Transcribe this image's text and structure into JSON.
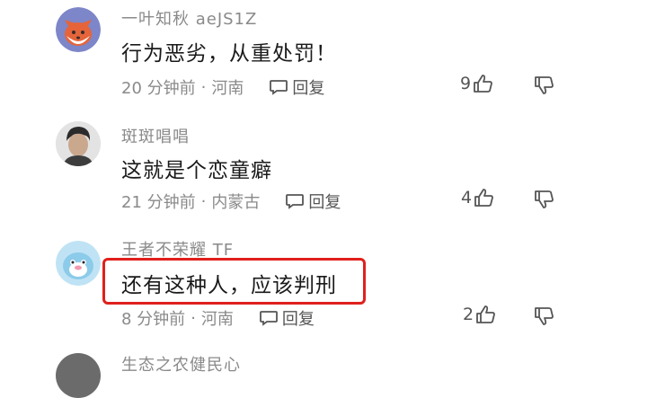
{
  "comments": [
    {
      "username": "一叶知秋 aeJS1Z",
      "content": "行为恶劣，从重处罚！",
      "time": "20 分钟前",
      "location": "河南",
      "reply_label": "回复",
      "likes": "9"
    },
    {
      "username": "斑斑唱唱",
      "content": "这就是个恋童癖",
      "time": "21 分钟前",
      "location": "内蒙古",
      "reply_label": "回复",
      "likes": "4"
    },
    {
      "username": "王者不荣耀 TF",
      "content": "还有这种人，应该判刑",
      "time": "8 分钟前",
      "location": "河南",
      "reply_label": "回复",
      "likes": "2"
    },
    {
      "username": "生态之农健民心"
    }
  ],
  "colors": {
    "highlight": "#e0201c",
    "meta_text": "#8a8a8a"
  },
  "icons": [
    "fox-avatar-icon",
    "comment-bubble-icon",
    "thumbs-up-icon",
    "thumbs-down-icon"
  ]
}
